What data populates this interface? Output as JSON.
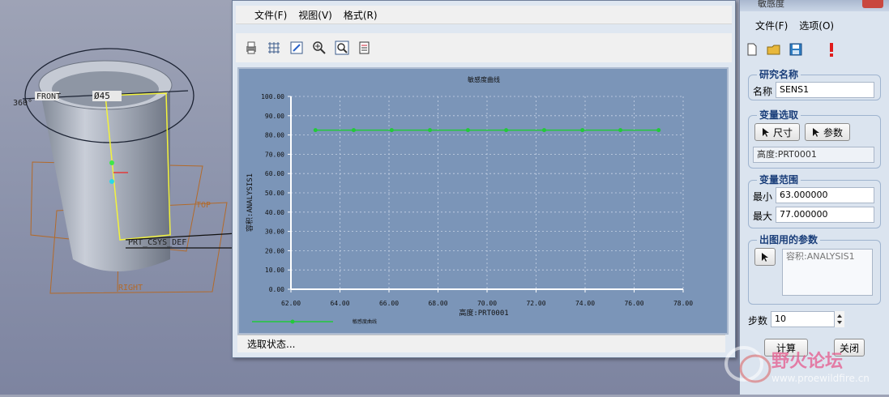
{
  "viewport": {
    "labels": {
      "angle": "360°",
      "front": "FRONT",
      "diameter": "Ø45",
      "top": "TOP",
      "right": "RIGHT",
      "csys": "PRT_CSYS_DEF"
    }
  },
  "graph_window": {
    "menu": [
      "文件(F)",
      "视图(V)",
      "格式(R)"
    ],
    "toolbar_icons": [
      "print-icon",
      "grid-icon",
      "edit-icon",
      "zoom-in-icon",
      "zoom-fit-icon",
      "export-icon"
    ],
    "status": "选取状态..."
  },
  "chart_data": {
    "type": "line",
    "title": "敏感度曲线",
    "xlabel": "高度:PRT0001",
    "ylabel": "容积:ANALYSIS1",
    "xlim": [
      62.0,
      78.0
    ],
    "ylim": [
      0.0,
      100.0
    ],
    "x_ticks": [
      "62.00",
      "64.00",
      "66.00",
      "68.00",
      "70.00",
      "72.00",
      "74.00",
      "76.00",
      "78.00"
    ],
    "y_ticks": [
      "0.00",
      "10.00",
      "20.00",
      "30.00",
      "40.00",
      "50.00",
      "60.00",
      "70.00",
      "80.00",
      "90.00",
      "100.00"
    ],
    "grid": true,
    "legend_position": "bottom-left",
    "series": [
      {
        "name": "敏感度曲线",
        "color": "#22c93a",
        "x": [
          63.0,
          64.56,
          66.11,
          67.67,
          69.22,
          70.78,
          72.33,
          73.89,
          75.44,
          77.0
        ],
        "y": [
          82.5,
          82.5,
          82.5,
          82.5,
          82.5,
          82.5,
          82.5,
          82.5,
          82.5,
          82.5
        ]
      }
    ]
  },
  "panel": {
    "title": "敏感度",
    "menu": [
      "文件(F)",
      "选项(O)"
    ],
    "study_name": {
      "title": "研究名称",
      "label": "名称",
      "value": "SENS1"
    },
    "variable": {
      "title": "变量选取",
      "dim_button": "尺寸",
      "param_button": "参数",
      "value": "高度:PRT0001"
    },
    "range": {
      "title": "变量范围",
      "min_label": "最小",
      "min_value": "63.000000",
      "max_label": "最大",
      "max_value": "77.000000"
    },
    "plot_params": {
      "title": "出图用的参数",
      "list_item": "容积:ANALYSIS1"
    },
    "steps": {
      "label": "步数",
      "value": "10"
    },
    "compute_button": "计算",
    "close_button": "关闭"
  },
  "watermark": {
    "text": "野火论坛",
    "url": "www.proewildfire.cn"
  }
}
